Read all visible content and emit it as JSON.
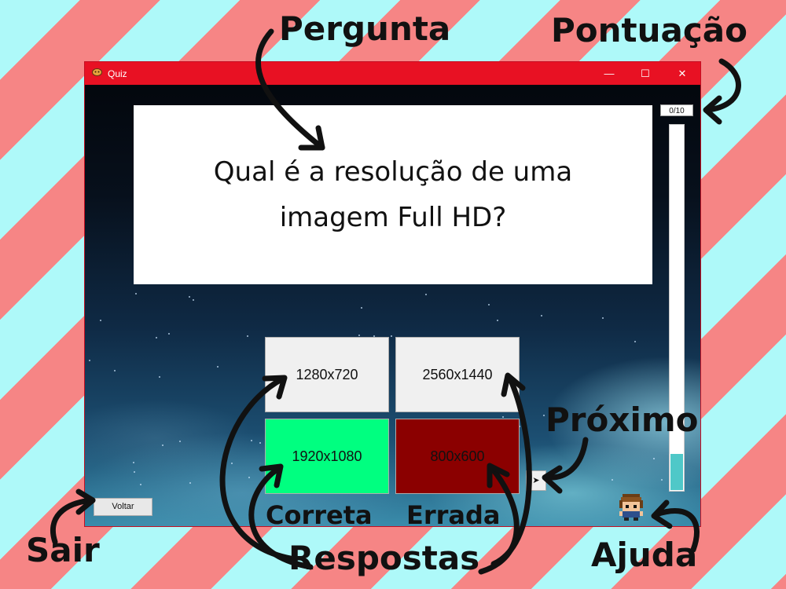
{
  "window": {
    "title": "Quiz",
    "controls": {
      "minimize": "—",
      "maximize": "☐",
      "close": "✕"
    },
    "titlebar_color": "#e81123"
  },
  "question": {
    "text": "Qual é a resolução de uma imagem Full HD?"
  },
  "answers": [
    {
      "label": "1280x720",
      "state": "neutral",
      "color": "#f0f0f0"
    },
    {
      "label": "2560x1440",
      "state": "neutral",
      "color": "#f0f0f0"
    },
    {
      "label": "1920x1080",
      "state": "correct",
      "color": "#00ff80"
    },
    {
      "label": "800x600",
      "state": "wrong",
      "color": "#8b0000"
    }
  ],
  "score": {
    "text": "0/10",
    "progress_fraction": 0.1,
    "fill_color": "#4fc8c8"
  },
  "next_button": {
    "label": "➤"
  },
  "back_button": {
    "label": "Voltar"
  },
  "annotations": {
    "pergunta": "Pergunta",
    "pontuacao": "Pontuação",
    "proximo": "Próximo",
    "correta": "Correta",
    "errada": "Errada",
    "sair": "Sair",
    "respostas": "Respostas",
    "ajuda": "Ajuda"
  }
}
